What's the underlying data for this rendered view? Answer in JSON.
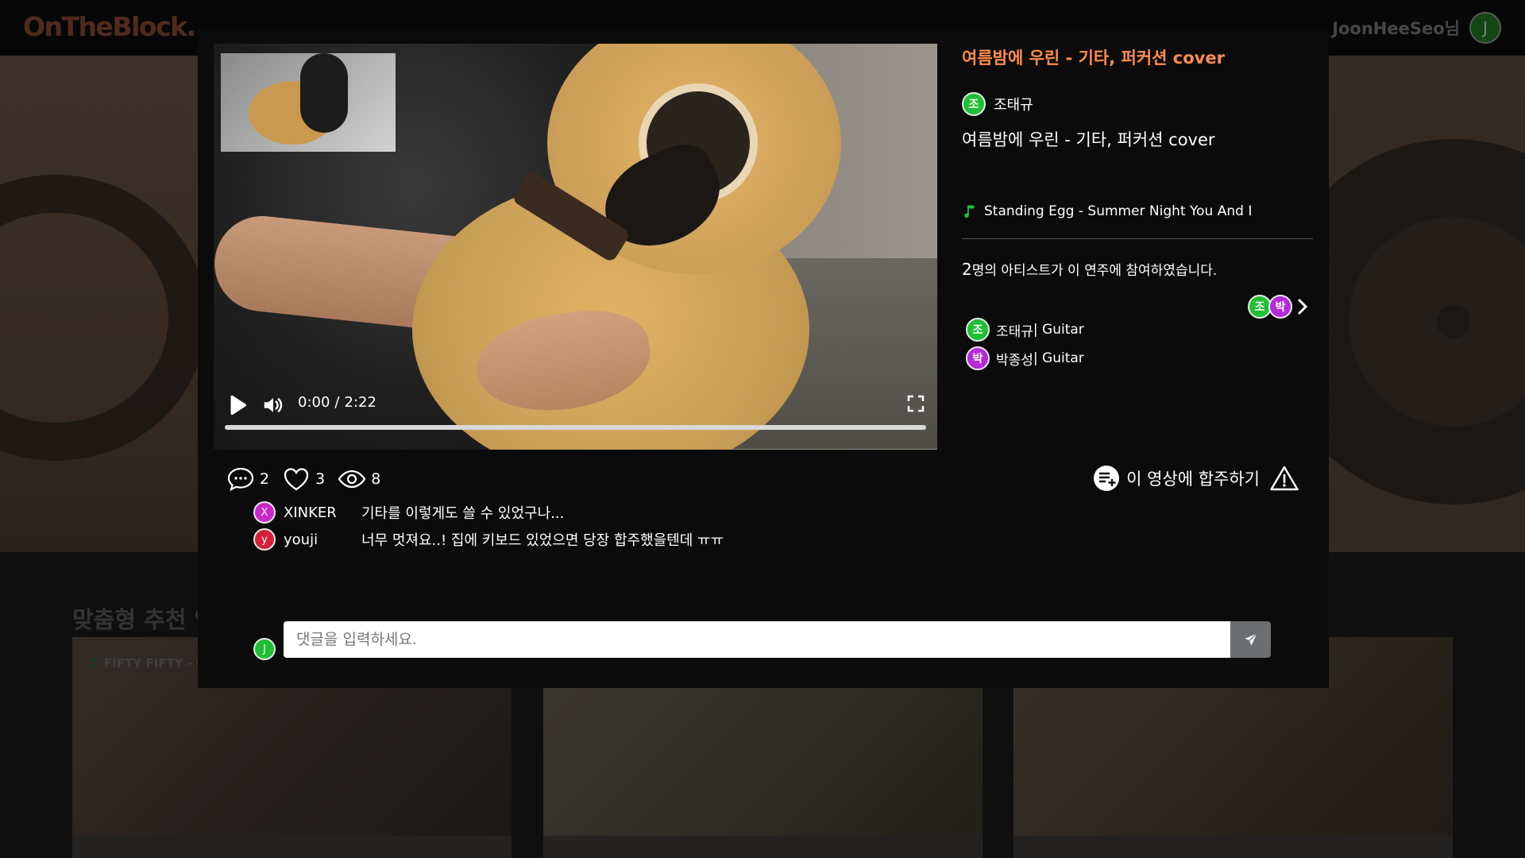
{
  "header": {
    "logo": "OnTheBlock.",
    "username": "JoonHeeSeo",
    "username_suffix": "님",
    "avatar_initial": "J"
  },
  "background": {
    "section_title": "맞춤형 추천 연",
    "first_card_label": "FIFTY FIFTY - Cu"
  },
  "video": {
    "time_current": "0:00",
    "time_separator": "/",
    "time_total": "2:22",
    "progress": 0
  },
  "info": {
    "title": "여름밤에 우린 - 기타, 퍼커션 cover",
    "uploader_initial": "조",
    "uploader_name": "조태규",
    "description": "여름밤에 우린 - 기타, 퍼커션 cover",
    "song": "Standing Egg - Summer Night You And I",
    "artist_count_number": "2",
    "artist_count_text": "명의 아티스트가 이 연주에 참여하였습니다.",
    "artist_stack": [
      {
        "initial": "조",
        "color": "#1fbf34"
      },
      {
        "initial": "박",
        "color": "#b529d8"
      }
    ],
    "artists": [
      {
        "initial": "조",
        "name": "조태규",
        "part": " | Guitar",
        "color": "#1fbf34"
      },
      {
        "initial": "박",
        "name": "박종성",
        "part": " | Guitar",
        "color": "#b529d8"
      }
    ]
  },
  "stats": {
    "comments": "2",
    "likes": "3",
    "views": "8"
  },
  "collab": {
    "label": "이 영상에 합주하기"
  },
  "comments": [
    {
      "initial": "X",
      "user": "XINKER",
      "text": "기타를 이렇게도 쓸 수 있었구나...",
      "color": "#c829c8"
    },
    {
      "initial": "y",
      "user": "youji",
      "text": "너무 멋져요..! 집에 키보드 있었으면 당장 합주했을텐데 ㅠㅠ",
      "color": "#d6203a"
    }
  ],
  "comment_input": {
    "avatar_initial": "J",
    "placeholder": "댓글을 입력하세요."
  },
  "colors": {
    "accent": "#ff8c4b",
    "user_green": "#1fbf34",
    "user_purple": "#b529d8"
  }
}
